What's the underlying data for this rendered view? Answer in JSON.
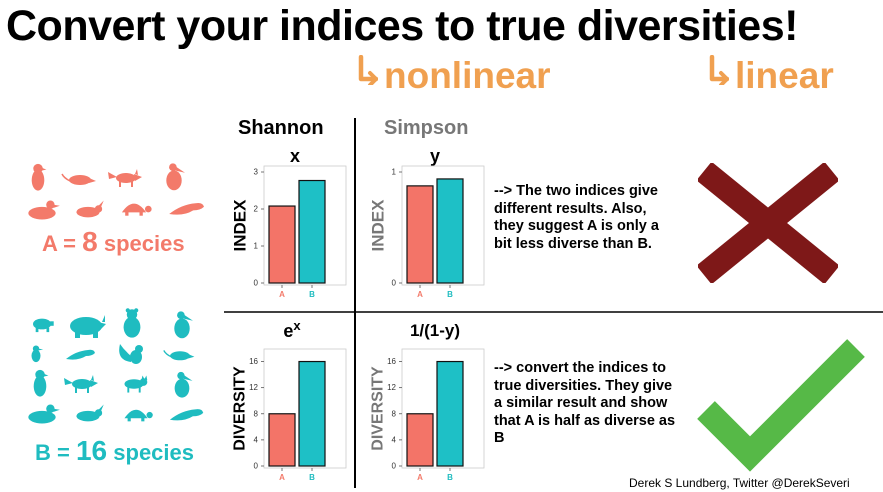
{
  "title": "Convert your indices to true diversities!",
  "hooks": {
    "nonlinear": "nonlinear",
    "linear": "linear"
  },
  "colors": {
    "hook": "#f0a050",
    "group_a": "#f37a6a",
    "group_b": "#1fbcc0",
    "bar_a": "#f37468",
    "bar_b": "#1ec0c6",
    "cross": "#7e1818",
    "check": "#56b947",
    "simpson_header": "#777777"
  },
  "groups": {
    "a": {
      "label_prefix": "A =",
      "count": "8",
      "label_suffix": "species",
      "icons": [
        "penguin-icon",
        "rat-icon",
        "fox-icon",
        "pelican-icon",
        "duck-icon",
        "rabbit-icon",
        "turtle-icon",
        "seal-icon"
      ]
    },
    "b": {
      "label_prefix": "B =",
      "count": "16",
      "label_suffix": "species",
      "icons": [
        "pig-icon",
        "rhino-icon",
        "bear-icon",
        "pelican-icon",
        "bird-icon",
        "seal-icon",
        "squirrel-icon",
        "rat-icon",
        "penguin-icon",
        "fox-icon",
        "cat-icon",
        "pelican-icon",
        "duck-icon",
        "rabbit-icon",
        "turtle-icon",
        "seal-icon"
      ]
    }
  },
  "columns": {
    "shannon": "Shannon",
    "simpson": "Simpson"
  },
  "row_labels": {
    "index": "INDEX",
    "diversity": "DIVERSITY"
  },
  "formulas": {
    "shannon_index": "x",
    "simpson_index": "y",
    "shannon_div_base": "e",
    "shannon_div_exp": "x",
    "simpson_div": "1/(1-y)"
  },
  "notes": {
    "top": "--> The two indices give different results. Also, they suggest A is only a bit less diverse than B.",
    "bottom": "--> convert the indices to true diversities. They give a similar result and show that A is half as diverse as B"
  },
  "verdicts": {
    "top": "cross-icon",
    "bottom": "checkmark-icon"
  },
  "credit": "Derek S Lundberg, Twitter @DerekSeveri",
  "chart_data": [
    {
      "id": "shannon-index",
      "type": "bar",
      "categories": [
        "A",
        "B"
      ],
      "values": [
        2.08,
        2.77
      ],
      "ylim": [
        0,
        3
      ],
      "yticks": [
        "0",
        "1",
        "2",
        "3"
      ],
      "grid": false
    },
    {
      "id": "simpson-index",
      "type": "bar",
      "categories": [
        "A",
        "B"
      ],
      "values": [
        0.875,
        0.9375
      ],
      "ylim": [
        0,
        1
      ],
      "yticks": [
        "0",
        "1"
      ],
      "grid": false
    },
    {
      "id": "shannon-diversity",
      "type": "bar",
      "categories": [
        "A",
        "B"
      ],
      "values": [
        8,
        16
      ],
      "ylim": [
        0,
        17
      ],
      "yticks": [
        "0",
        "4",
        "8",
        "12",
        "16"
      ],
      "grid": false
    },
    {
      "id": "simpson-diversity",
      "type": "bar",
      "categories": [
        "A",
        "B"
      ],
      "values": [
        8,
        16
      ],
      "ylim": [
        0,
        17
      ],
      "yticks": [
        "0",
        "4",
        "8",
        "12",
        "16"
      ],
      "grid": false
    }
  ]
}
